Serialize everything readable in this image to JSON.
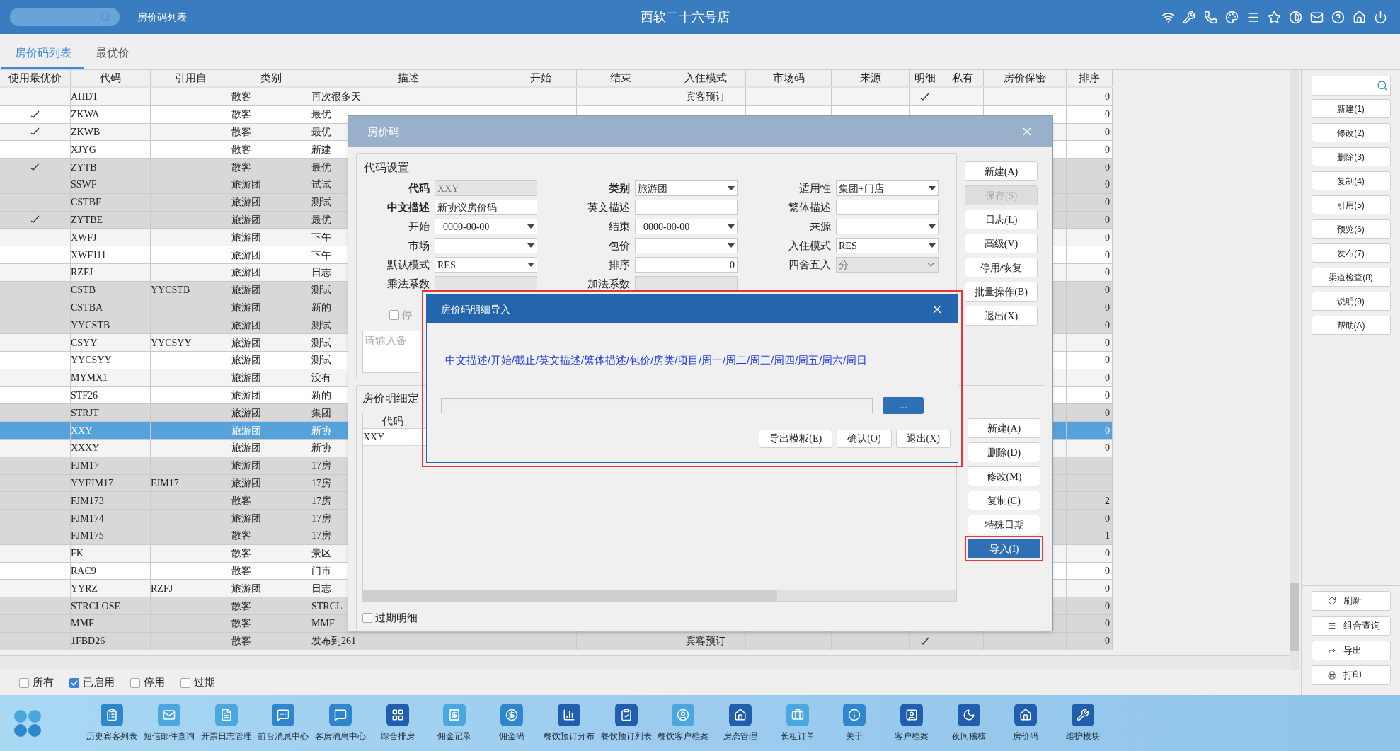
{
  "top_bar": {
    "breadcrumb": "房价码列表",
    "title": "西软二十六号店"
  },
  "tabs": [
    {
      "label": "房价码列表",
      "selected": true
    },
    {
      "label": "最优价",
      "selected": false
    }
  ],
  "table": {
    "columns": [
      "使用最优价",
      "代码",
      "引用自",
      "类别",
      "描述",
      "开始",
      "结束",
      "入住模式",
      "市场码",
      "来源",
      "明细",
      "私有",
      "房价保密",
      "排序"
    ],
    "rows": [
      {
        "best_price": false,
        "code": "AHDT",
        "category": "散客",
        "description": "再次很多天",
        "checkin_mode": "宾客预订",
        "detail": true,
        "sort": "0",
        "dimmed": false,
        "selected": false
      },
      {
        "best_price": true,
        "code": "ZKWA",
        "category": "散客",
        "description": "最优",
        "sort": "0",
        "dimmed": false,
        "selected": false
      },
      {
        "best_price": true,
        "code": "ZKWB",
        "category": "散客",
        "description": "最优",
        "sort": "0",
        "dimmed": false,
        "selected": false
      },
      {
        "best_price": false,
        "code": "XJYG",
        "category": "散客",
        "description": "新建",
        "sort": "0",
        "dimmed": false,
        "selected": false
      },
      {
        "best_price": true,
        "code": "ZYTB",
        "category": "散客",
        "description": "最优",
        "sort": "0",
        "dimmed": true,
        "selected": false
      },
      {
        "best_price": false,
        "code": "SSWF",
        "category": "旅游团",
        "description": "试试",
        "sort": "0",
        "dimmed": true,
        "selected": false
      },
      {
        "best_price": false,
        "code": "CSTBE",
        "category": "旅游团",
        "description": "测试",
        "sort": "0",
        "dimmed": true,
        "selected": false
      },
      {
        "best_price": true,
        "code": "ZYTBE",
        "category": "旅游团",
        "description": "最优",
        "sort": "0",
        "dimmed": true,
        "selected": false
      },
      {
        "best_price": false,
        "code": "XWFJ",
        "category": "旅游团",
        "description": "下午",
        "sort": "0",
        "dimmed": false,
        "selected": false
      },
      {
        "best_price": false,
        "code": "XWFJ11",
        "category": "旅游团",
        "description": "下午",
        "sort": "0",
        "dimmed": false,
        "selected": false
      },
      {
        "best_price": false,
        "code": "RZFJ",
        "category": "旅游团",
        "description": "日志",
        "sort": "0",
        "dimmed": false,
        "selected": false
      },
      {
        "best_price": false,
        "code": "CSTB",
        "ref": "YYCSTB",
        "category": "旅游团",
        "description": "测试",
        "sort": "0",
        "dimmed": true,
        "selected": false
      },
      {
        "best_price": false,
        "code": "CSTBA",
        "category": "旅游团",
        "description": "新的",
        "sort": "0",
        "dimmed": true,
        "selected": false
      },
      {
        "best_price": false,
        "code": "YYCSTB",
        "category": "旅游团",
        "description": "测试",
        "sort": "0",
        "dimmed": true,
        "selected": false
      },
      {
        "best_price": false,
        "code": "CSYY",
        "ref": "YYCSYY",
        "category": "旅游团",
        "description": "测试",
        "sort": "0",
        "dimmed": false,
        "selected": false
      },
      {
        "best_price": false,
        "code": "YYCSYY",
        "category": "旅游团",
        "description": "测试",
        "sort": "0",
        "dimmed": false,
        "selected": false
      },
      {
        "best_price": false,
        "code": "MYMX1",
        "category": "旅游团",
        "description": "没有",
        "sort": "0",
        "dimmed": false,
        "selected": false
      },
      {
        "best_price": false,
        "code": "STF26",
        "category": "旅游团",
        "description": "新的",
        "sort": "0",
        "dimmed": false,
        "selected": false
      },
      {
        "best_price": false,
        "code": "STRJT",
        "category": "旅游团",
        "description": "集团",
        "sort": "0",
        "dimmed": true,
        "selected": false
      },
      {
        "best_price": false,
        "code": "XXY",
        "category": "旅游团",
        "description": "新协",
        "sort": "0",
        "dimmed": false,
        "selected": true
      },
      {
        "best_price": false,
        "code": "XXXY",
        "category": "旅游团",
        "description": "新协",
        "sort": "0",
        "dimmed": false,
        "selected": false
      },
      {
        "best_price": false,
        "code": "FJM17",
        "category": "旅游团",
        "description": "17房",
        "dimmed": true,
        "selected": false
      },
      {
        "best_price": false,
        "code": "YYFJM17",
        "ref": "FJM17",
        "category": "旅游团",
        "description": "17房",
        "dimmed": true,
        "selected": false
      },
      {
        "best_price": false,
        "code": "FJM173",
        "category": "散客",
        "description": "17房",
        "sort": "2",
        "dimmed": true,
        "selected": false
      },
      {
        "best_price": false,
        "code": "FJM174",
        "category": "旅游团",
        "description": "17房",
        "sort": "0",
        "dimmed": true,
        "selected": false
      },
      {
        "best_price": false,
        "code": "FJM175",
        "category": "散客",
        "description": "17房",
        "sort": "1",
        "dimmed": true,
        "selected": false
      },
      {
        "best_price": false,
        "code": "FK",
        "category": "散客",
        "description": "景区",
        "sort": "0",
        "dimmed": false,
        "selected": false
      },
      {
        "best_price": false,
        "code": "RAC9",
        "category": "散客",
        "description": "门市",
        "sort": "0",
        "dimmed": false,
        "selected": false
      },
      {
        "best_price": false,
        "code": "YYRZ",
        "ref": "RZFJ",
        "category": "旅游团",
        "description": "日志",
        "sort": "0",
        "dimmed": false,
        "selected": false
      },
      {
        "best_price": false,
        "code": "STRCLOSE",
        "category": "散客",
        "description": "STRCL",
        "sort": "0",
        "dimmed": true,
        "selected": false
      },
      {
        "best_price": false,
        "code": "MMF",
        "category": "散客",
        "description": "MMF",
        "sort": "0",
        "dimmed": true,
        "selected": false
      },
      {
        "best_price": false,
        "code": "1FBD26",
        "category": "散客",
        "description": "发布到261",
        "checkin_mode": "宾客预订",
        "detail": true,
        "sort": "0",
        "dimmed": true,
        "selected": false
      }
    ]
  },
  "filters": [
    {
      "label": "所有",
      "checked": false
    },
    {
      "label": "已启用",
      "checked": true
    },
    {
      "label": "停用",
      "checked": false
    },
    {
      "label": "过期",
      "checked": false
    }
  ],
  "side_panel": {
    "actions": [
      "新建(1)",
      "修改(2)",
      "删除(3)",
      "复制(4)",
      "引用(5)",
      "预览(6)",
      "发布(7)",
      "渠道检查(8)",
      "说明(9)",
      "帮助(A)"
    ],
    "bottom_actions": [
      "刷新",
      "组合查询",
      "导出",
      "打印"
    ]
  },
  "rate_dialog": {
    "title": "房价码",
    "code_settings": {
      "title": "代码设置",
      "rows": [
        [
          {
            "label": "代码",
            "value": "XXY",
            "kind": "text",
            "required": true,
            "disabled": true
          },
          {
            "label": "类别",
            "value": "旅游团",
            "kind": "select",
            "required": true,
            "disabled": false
          },
          {
            "label": "适用性",
            "value": "集团+门店",
            "kind": "select",
            "required": false,
            "disabled": false
          }
        ],
        [
          {
            "label": "中文描述",
            "value": "新协议房价码",
            "kind": "text",
            "required": true,
            "disabled": false
          },
          {
            "label": "英文描述",
            "kind": "text",
            "required": false,
            "disabled": false
          },
          {
            "label": "繁体描述",
            "kind": "text",
            "required": false,
            "disabled": false
          }
        ],
        [
          {
            "label": "开始",
            "value": "0000-00-00",
            "kind": "select",
            "required": false,
            "disabled": false
          },
          {
            "label": "结束",
            "value": "0000-00-00",
            "kind": "select",
            "required": false,
            "disabled": false
          },
          {
            "label": "来源",
            "kind": "select",
            "required": false,
            "disabled": false
          }
        ],
        [
          {
            "label": "市场",
            "kind": "select",
            "required": false,
            "disabled": false
          },
          {
            "label": "包价",
            "kind": "select",
            "required": false,
            "disabled": false
          },
          {
            "label": "入住模式",
            "value": "RES",
            "kind": "select",
            "required": false,
            "disabled": false
          }
        ],
        [
          {
            "label": "默认模式",
            "value": "RES",
            "kind": "select",
            "required": false,
            "disabled": false
          },
          {
            "label": "排序",
            "value": "0",
            "kind": "number",
            "required": false,
            "disabled": false
          },
          {
            "label": "四舍五入",
            "value": "分",
            "kind": "select",
            "required": false,
            "disabled": true
          }
        ],
        [
          {
            "label": "乘法系数",
            "kind": "text",
            "required": false,
            "disabled": true
          },
          {
            "label": "加法系数",
            "kind": "text",
            "required": false,
            "disabled": true
          }
        ]
      ],
      "disable_checkbox": {
        "label": "停",
        "checked": false
      },
      "remark": {
        "placeholder": "请输入备"
      }
    },
    "buttons": [
      {
        "label": "新建(A)",
        "disabled": false
      },
      {
        "label": "保存(S)",
        "disabled": true
      },
      {
        "label": "日志(L)",
        "disabled": false
      },
      {
        "label": "高级(V)",
        "disabled": false
      },
      {
        "label": "停用/恢复",
        "disabled": false
      },
      {
        "label": "批量操作(B)",
        "disabled": false
      },
      {
        "label": "退出(X)",
        "disabled": false
      }
    ],
    "details": {
      "title": "房价明细定",
      "columns": [
        "代码"
      ],
      "rows": [
        "XXY"
      ],
      "expired_checkbox": {
        "label": "过期明细",
        "checked": false
      },
      "buttons": [
        {
          "label": "新建(A)",
          "primary": false
        },
        {
          "label": "删除(D)",
          "primary": false
        },
        {
          "label": "修改(M)",
          "primary": false
        },
        {
          "label": "复制(C)",
          "primary": false
        },
        {
          "label": "特殊日期",
          "primary": false
        },
        {
          "label": "导入(I)",
          "primary": true
        }
      ]
    }
  },
  "import_dialog": {
    "title": "房价码明细导入",
    "format": "中文描述/开始/截止/英文描述/繁体描述/包价/房类/项目/周一/周二/周三/周四/周五/周六/周日",
    "browse": "...",
    "buttons": [
      "导出模板(E)",
      "确认(O)",
      "退出(X)"
    ]
  },
  "taskbar": [
    "历史宾客列表",
    "短信邮件查询",
    "开票日志管理",
    "前台消息中心",
    "客房消息中心",
    "综合排房",
    "佣金记录",
    "佣金码",
    "餐饮预订分布",
    "餐饮预订列表",
    "餐饮客户档案",
    "房态管理",
    "长租订单",
    "关于",
    "客户档案",
    "夜间稽核",
    "房价码",
    "维护模块"
  ]
}
